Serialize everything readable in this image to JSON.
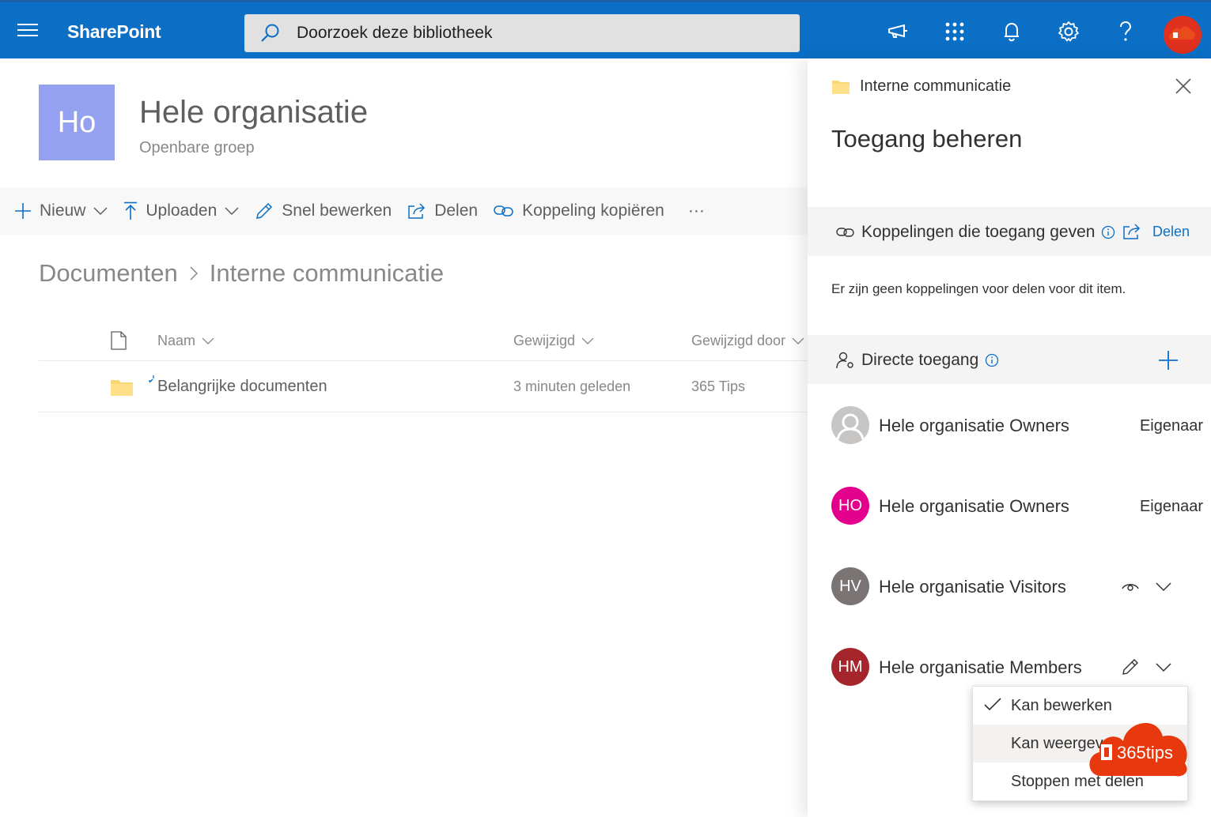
{
  "suitebar": {
    "brand": "SharePoint",
    "search_placeholder": "Doorzoek deze bibliotheek",
    "icons": [
      "menu-icon",
      "search-icon",
      "megaphone-icon",
      "app-launcher-icon",
      "bell-icon",
      "gear-icon",
      "help-icon"
    ],
    "accent": "#0b6fc6"
  },
  "site": {
    "logo_initials": "Ho",
    "title": "Hele organisatie",
    "subtitle": "Openbare groep",
    "logo_color": "#93a1f0"
  },
  "commands": {
    "new": "Nieuw",
    "upload": "Uploaden",
    "quick_edit": "Snel bewerken",
    "share": "Delen",
    "copy_link": "Koppeling kopiëren",
    "more": "···"
  },
  "breadcrumb": {
    "root": "Documenten",
    "current": "Interne communicatie"
  },
  "list": {
    "headers": {
      "name": "Naam",
      "modified": "Gewijzigd",
      "modified_by": "Gewijzigd door"
    },
    "rows": [
      {
        "name": "Belangrijke documenten",
        "modified": "3 minuten geleden",
        "modified_by": "365 Tips"
      }
    ]
  },
  "panel": {
    "folder_name": "Interne communicatie",
    "title": "Toegang beheren",
    "links_section": {
      "label": "Koppelingen die toegang geven",
      "share_label": "Delen",
      "empty_text": "Er zijn geen koppelingen voor delen voor dit item."
    },
    "direct_section": {
      "label": "Directe toegang"
    },
    "people": [
      {
        "initials": "",
        "name": "Hele organisatie Owners",
        "role": "Eigenaar",
        "color": "#c8c6c4"
      },
      {
        "initials": "HO",
        "name": "Hele organisatie Owners",
        "role": "Eigenaar",
        "color": "#e3008c"
      },
      {
        "initials": "HV",
        "name": "Hele organisatie Visitors",
        "permission_icon": "eye-icon",
        "color": "#7a7574"
      },
      {
        "initials": "HM",
        "name": "Hele organisatie Members",
        "permission_icon": "pencil-icon",
        "color": "#a4262c"
      }
    ],
    "dropdown": {
      "items": [
        "Kan bewerken",
        "Kan weergeven",
        "Stoppen met delen"
      ],
      "selected": "Kan bewerken",
      "hovered": "Kan weergeven"
    }
  },
  "watermark": {
    "text": "365tips",
    "color": "#e8380d"
  }
}
